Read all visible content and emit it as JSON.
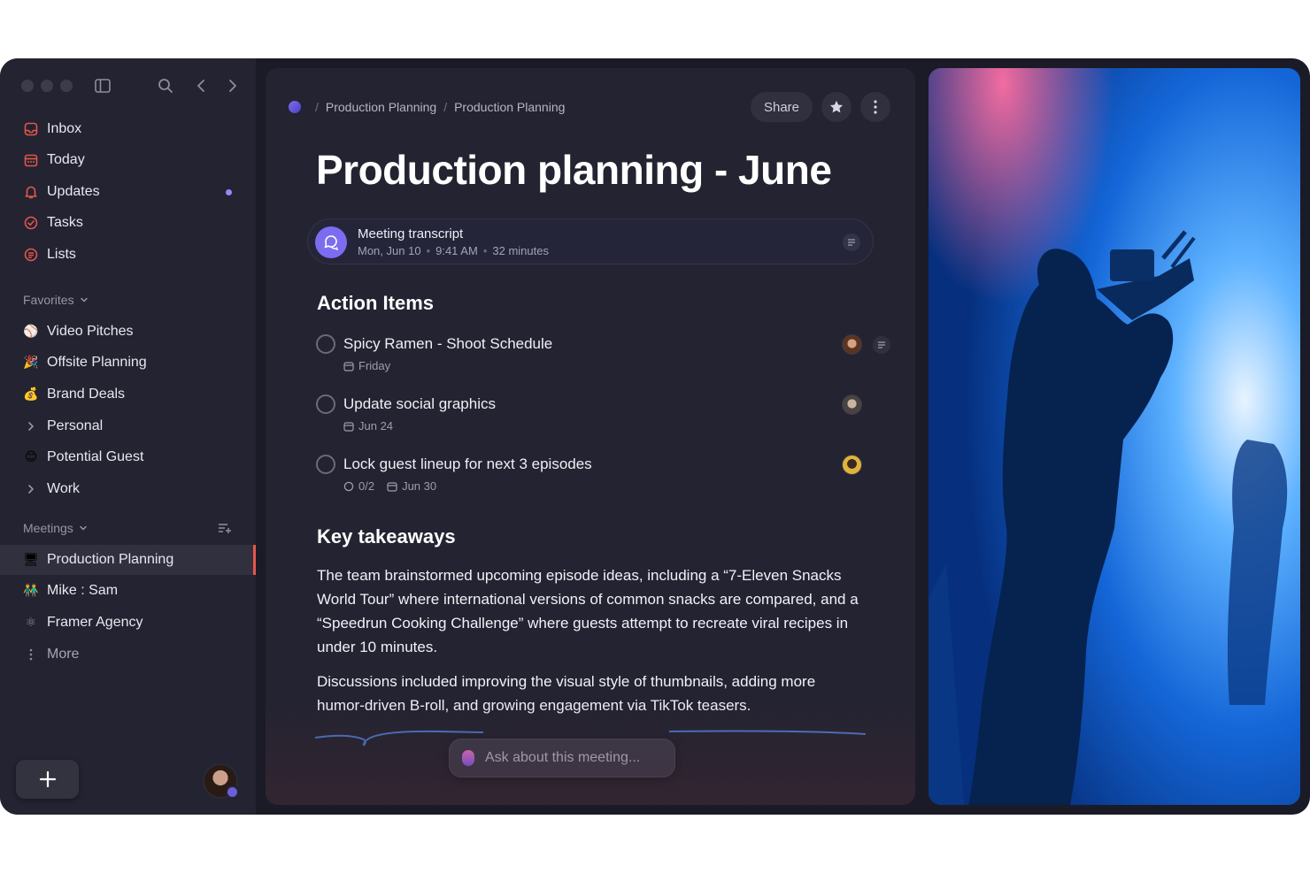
{
  "sidebar": {
    "primary": [
      {
        "label": "Inbox",
        "icon": "inbox-icon"
      },
      {
        "label": "Today",
        "icon": "calendar-icon"
      },
      {
        "label": "Updates",
        "icon": "bell-icon"
      },
      {
        "label": "Tasks",
        "icon": "check-circle-icon"
      },
      {
        "label": "Lists",
        "icon": "list-icon"
      }
    ],
    "favorites": {
      "title": "Favorites",
      "items": [
        {
          "label": "Video Pitches",
          "emoji": "⚾"
        },
        {
          "label": "Offsite Planning",
          "emoji": "🎉"
        },
        {
          "label": "Brand Deals",
          "emoji": "💰"
        },
        {
          "label": "Personal",
          "icon": "chevron-right-icon"
        },
        {
          "label": "Potential Guest",
          "emoji": "😊"
        },
        {
          "label": "Work",
          "icon": "chevron-right-icon"
        }
      ]
    },
    "meetings": {
      "title": "Meetings",
      "items": [
        {
          "label": "Production Planning",
          "emoji": "🖥"
        },
        {
          "label": "Mike : Sam",
          "emoji": "👬"
        },
        {
          "label": "Framer Agency",
          "emoji": "⚛"
        },
        {
          "label": "More",
          "icon": "more-vertical-icon"
        }
      ]
    }
  },
  "breadcrumb": [
    "Production Planning",
    "Production Planning"
  ],
  "toolbar": {
    "share_label": "Share"
  },
  "page": {
    "title": "Production planning - June"
  },
  "transcript": {
    "title": "Meeting transcript",
    "date": "Mon, Jun 10",
    "time": "9:41 AM",
    "duration": "32 minutes"
  },
  "action_items": {
    "heading": "Action Items",
    "items": [
      {
        "title": "Spicy Ramen - Shoot Schedule",
        "due": "Friday"
      },
      {
        "title": "Update social graphics",
        "due": "Jun 24"
      },
      {
        "title": "Lock guest lineup for next 3 episodes",
        "subtasks": "0/2",
        "due": "Jun 30"
      }
    ]
  },
  "takeaways": {
    "heading": "Key takeaways",
    "paragraphs": [
      "The team brainstormed upcoming episode ideas, including a “7-Eleven Snacks World Tour” where international versions of common snacks are compared, and a “Speedrun Cooking Challenge” where guests attempt to recreate viral recipes in under 10 minutes.",
      "Discussions included improving the visual style of thumbnails, adding more humor-driven B-roll, and growing engagement via TikTok teasers."
    ]
  },
  "ask": {
    "placeholder": "Ask about this meeting..."
  },
  "colors": {
    "accent": "#7c6df0",
    "active_marker": "#e4574a",
    "updates_dot": "#9a86f5"
  }
}
